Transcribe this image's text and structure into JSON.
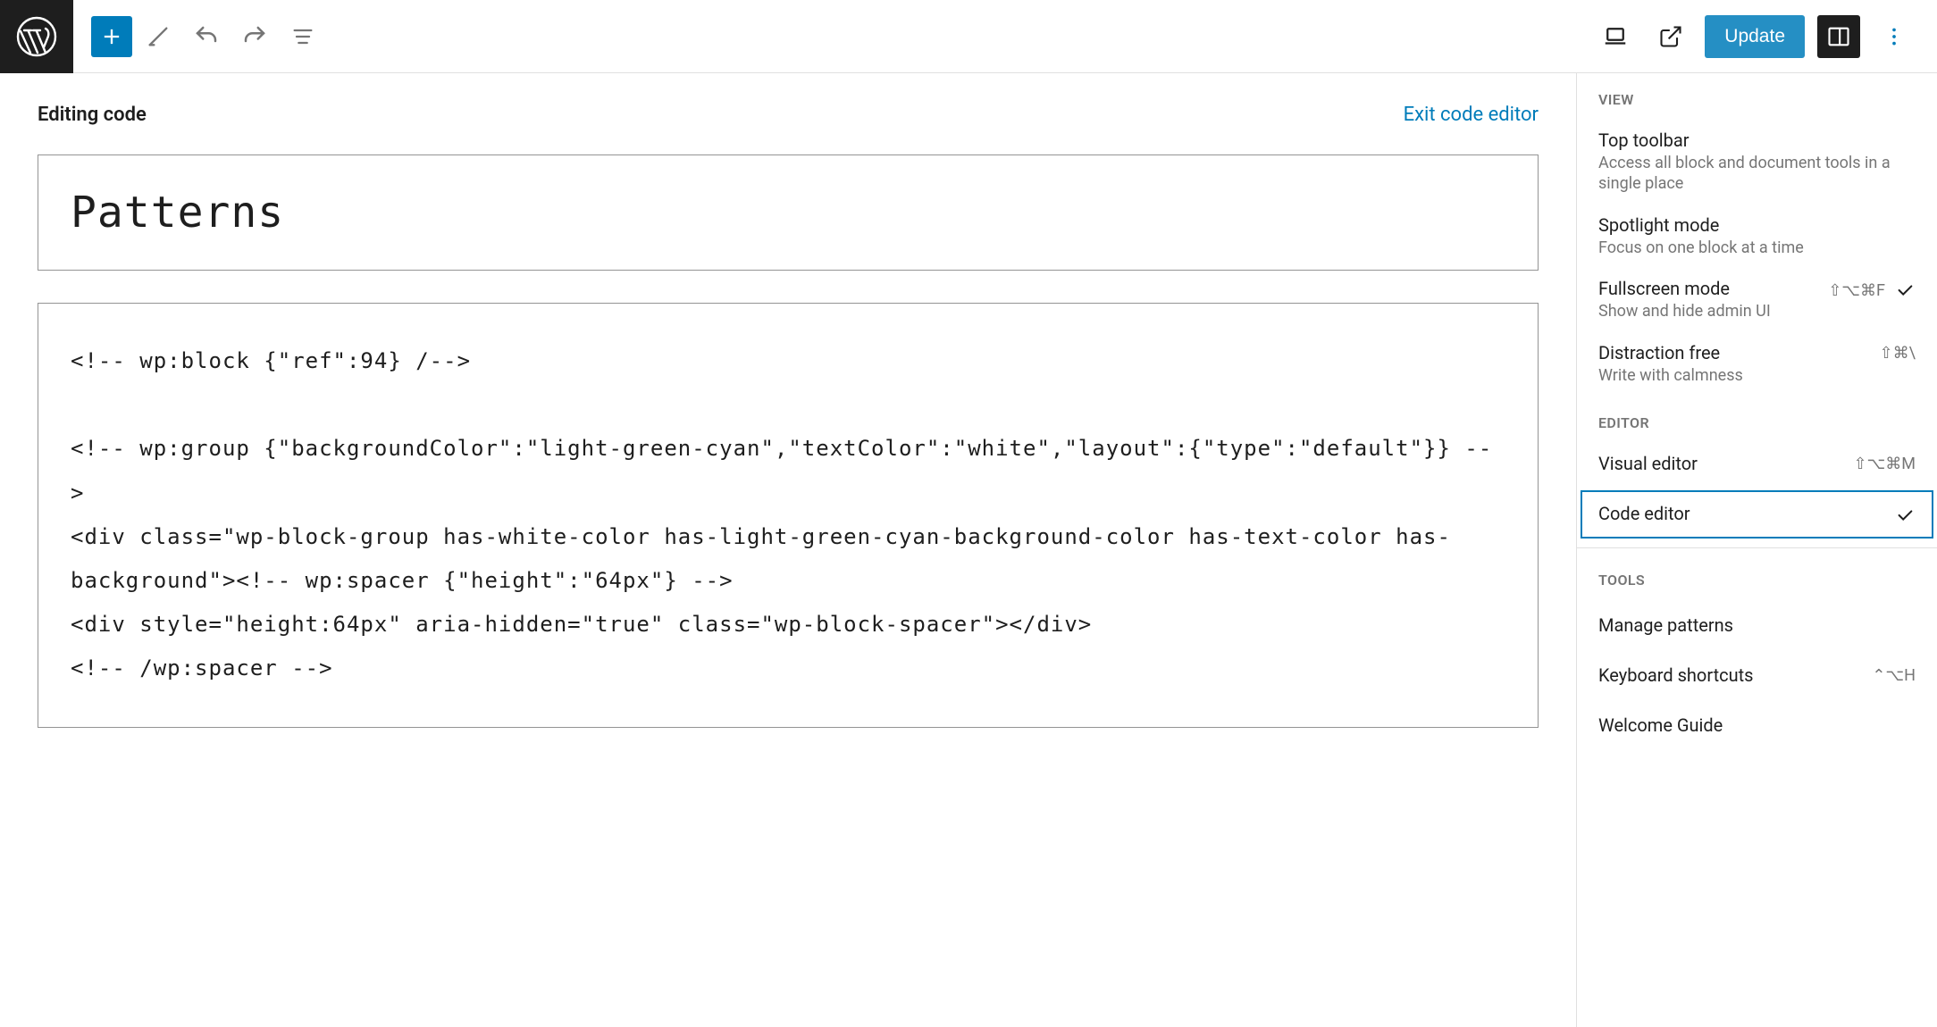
{
  "toolbar": {
    "update_label": "Update"
  },
  "code_header": {
    "editing_label": "Editing code",
    "exit_label": "Exit code editor"
  },
  "title": "Patterns",
  "code_content": "<!-- wp:block {\"ref\":94} /-->\n\n<!-- wp:group {\"backgroundColor\":\"light-green-cyan\",\"textColor\":\"white\",\"layout\":{\"type\":\"default\"}} -->\n<div class=\"wp-block-group has-white-color has-light-green-cyan-background-color has-text-color has-background\"><!-- wp:spacer {\"height\":\"64px\"} -->\n<div style=\"height:64px\" aria-hidden=\"true\" class=\"wp-block-spacer\"></div>\n<!-- /wp:spacer -->",
  "menu": {
    "view_label": "VIEW",
    "editor_label": "EDITOR",
    "tools_label": "TOOLS",
    "view_items": [
      {
        "title": "Top toolbar",
        "desc": "Access all block and document tools in a single place",
        "shortcut": "",
        "checked": false
      },
      {
        "title": "Spotlight mode",
        "desc": "Focus on one block at a time",
        "shortcut": "",
        "checked": false
      },
      {
        "title": "Fullscreen mode",
        "desc": "Show and hide admin UI",
        "shortcut": "⇧⌥⌘F",
        "checked": true
      },
      {
        "title": "Distraction free",
        "desc": "Write with calmness",
        "shortcut": "⇧⌘\\",
        "checked": false
      }
    ],
    "editor_items": [
      {
        "title": "Visual editor",
        "shortcut": "⇧⌥⌘M",
        "selected": false,
        "checked": false
      },
      {
        "title": "Code editor",
        "shortcut": "",
        "selected": true,
        "checked": true
      }
    ],
    "tools_items": [
      {
        "title": "Manage patterns",
        "shortcut": ""
      },
      {
        "title": "Keyboard shortcuts",
        "shortcut": "⌃⌥H"
      },
      {
        "title": "Welcome Guide",
        "shortcut": ""
      }
    ]
  }
}
